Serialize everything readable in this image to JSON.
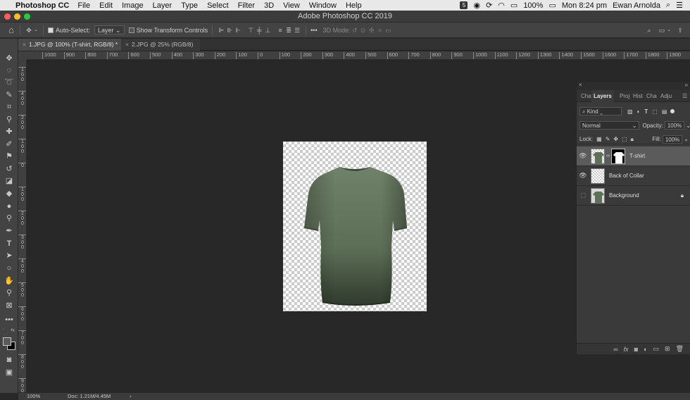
{
  "menubar": {
    "app_name": "Photoshop CC",
    "items": [
      "File",
      "Edit",
      "Image",
      "Layer",
      "Type",
      "Select",
      "Filter",
      "3D",
      "View",
      "Window",
      "Help"
    ],
    "battery": "100%",
    "clock": "Mon 8:24 pm",
    "user": "Ewan Arnolda"
  },
  "window": {
    "title": "Adobe Photoshop CC 2019"
  },
  "options_bar": {
    "auto_select_label": "Auto-Select:",
    "auto_select_value": "Layer",
    "show_transform_label": "Show Transform Controls",
    "mode_3d_label": "3D Mode:",
    "more_label": "•••"
  },
  "tabs": [
    {
      "label": "1.JPG @ 100% (T-shirt, RGB/8) *",
      "active": true
    },
    {
      "label": "2.JPG @ 25% (RGB/8)",
      "active": false
    }
  ],
  "ruler_h": [
    "1000",
    "900",
    "800",
    "700",
    "600",
    "500",
    "400",
    "300",
    "200",
    "100",
    "0",
    "100",
    "200",
    "300",
    "400",
    "500",
    "600",
    "700",
    "800",
    "900",
    "1000",
    "1100",
    "1200",
    "1300",
    "1400",
    "1500",
    "1600",
    "1700",
    "1800",
    "1900"
  ],
  "ruler_v": [
    "1\n0\n0",
    "4\n0\n0",
    "2\n0\n0",
    "1\n0\n0",
    "0",
    "1\n0\n0",
    "2\n0\n0",
    "3\n0\n0",
    "4\n0\n0",
    "5\n0\n0",
    "6\n0\n0",
    "7\n0\n0",
    "8\n0\n0",
    "9\n0\n0"
  ],
  "layers_panel": {
    "tabs": [
      "Cha",
      "Layers",
      "Proj",
      "Hist",
      "Cha",
      "Adju"
    ],
    "filter_value": "Kind",
    "blend_mode": "Normal",
    "opacity_label": "Opacity:",
    "opacity_value": "100%",
    "lock_label": "Lock:",
    "fill_label": "Fill:",
    "fill_value": "100%",
    "layers": [
      {
        "name": "T-shirt",
        "visible": true,
        "selected": true
      },
      {
        "name": "Back of Collar",
        "visible": true,
        "selected": false
      },
      {
        "name": "Background",
        "visible": false,
        "selected": false
      }
    ]
  },
  "status": {
    "zoom": "100%",
    "doc": "Doc: 1.21M/4.45M"
  },
  "colors": {
    "shirt": "#5e7058",
    "canvas_bg": "#282828",
    "accent_selected": "#5b5b5b"
  }
}
